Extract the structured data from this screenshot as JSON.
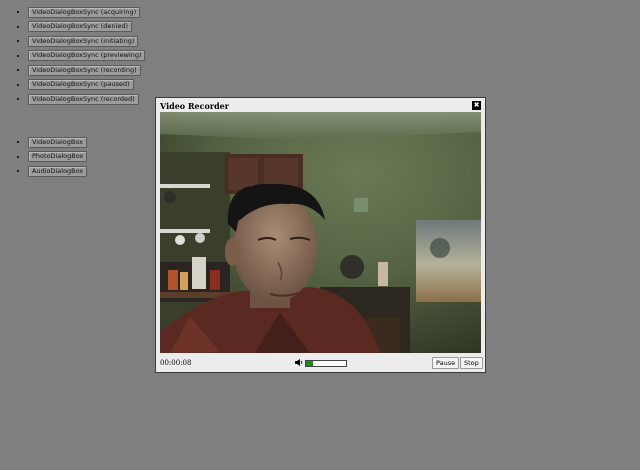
{
  "sync_buttons": [
    {
      "label": "VideoDialogBoxSync (acquiring)"
    },
    {
      "label": "VideoDialogBoxSync (denied)"
    },
    {
      "label": "VideoDialogBoxSync (initiating)"
    },
    {
      "label": "VideoDialogBoxSync (previewing)"
    },
    {
      "label": "VideoDialogBoxSync (recording)"
    },
    {
      "label": "VideoDialogBoxSync (paused)"
    },
    {
      "label": "VideoDialogBoxSync (recorded)"
    }
  ],
  "dialog_buttons": [
    {
      "label": "VideoDialogBox"
    },
    {
      "label": "PhotoDialogBox"
    },
    {
      "label": "AudioDialogBox"
    }
  ],
  "dialog": {
    "title": "Video Recorder",
    "close_glyph": "✖",
    "timer": "00:00:08",
    "audio_level": 0.18,
    "pause_label": "Pause",
    "stop_label": "Stop",
    "speaker_icon": "speaker-icon",
    "close_icon": "close-icon"
  },
  "colors": {
    "page_bg": "#7f7f7f",
    "dialog_bg": "#ececec",
    "meter_fill": "#1a8a1a"
  }
}
